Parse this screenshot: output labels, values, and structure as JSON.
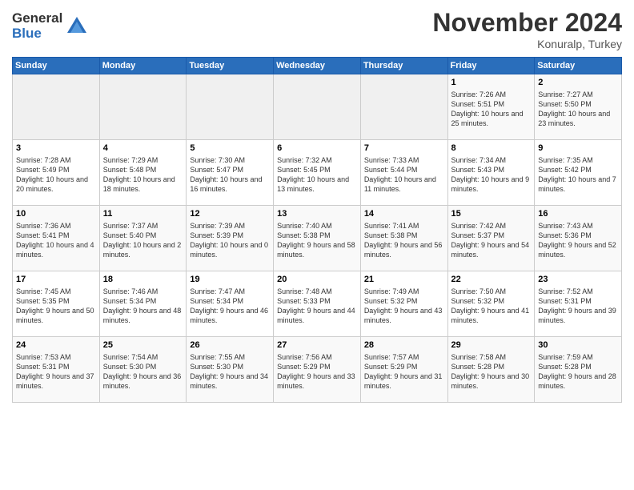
{
  "header": {
    "logo_line1": "General",
    "logo_line2": "Blue",
    "month": "November 2024",
    "location": "Konuralp, Turkey"
  },
  "weekdays": [
    "Sunday",
    "Monday",
    "Tuesday",
    "Wednesday",
    "Thursday",
    "Friday",
    "Saturday"
  ],
  "weeks": [
    [
      {
        "day": "",
        "info": ""
      },
      {
        "day": "",
        "info": ""
      },
      {
        "day": "",
        "info": ""
      },
      {
        "day": "",
        "info": ""
      },
      {
        "day": "",
        "info": ""
      },
      {
        "day": "1",
        "info": "Sunrise: 7:26 AM\nSunset: 5:51 PM\nDaylight: 10 hours and 25 minutes."
      },
      {
        "day": "2",
        "info": "Sunrise: 7:27 AM\nSunset: 5:50 PM\nDaylight: 10 hours and 23 minutes."
      }
    ],
    [
      {
        "day": "3",
        "info": "Sunrise: 7:28 AM\nSunset: 5:49 PM\nDaylight: 10 hours and 20 minutes."
      },
      {
        "day": "4",
        "info": "Sunrise: 7:29 AM\nSunset: 5:48 PM\nDaylight: 10 hours and 18 minutes."
      },
      {
        "day": "5",
        "info": "Sunrise: 7:30 AM\nSunset: 5:47 PM\nDaylight: 10 hours and 16 minutes."
      },
      {
        "day": "6",
        "info": "Sunrise: 7:32 AM\nSunset: 5:45 PM\nDaylight: 10 hours and 13 minutes."
      },
      {
        "day": "7",
        "info": "Sunrise: 7:33 AM\nSunset: 5:44 PM\nDaylight: 10 hours and 11 minutes."
      },
      {
        "day": "8",
        "info": "Sunrise: 7:34 AM\nSunset: 5:43 PM\nDaylight: 10 hours and 9 minutes."
      },
      {
        "day": "9",
        "info": "Sunrise: 7:35 AM\nSunset: 5:42 PM\nDaylight: 10 hours and 7 minutes."
      }
    ],
    [
      {
        "day": "10",
        "info": "Sunrise: 7:36 AM\nSunset: 5:41 PM\nDaylight: 10 hours and 4 minutes."
      },
      {
        "day": "11",
        "info": "Sunrise: 7:37 AM\nSunset: 5:40 PM\nDaylight: 10 hours and 2 minutes."
      },
      {
        "day": "12",
        "info": "Sunrise: 7:39 AM\nSunset: 5:39 PM\nDaylight: 10 hours and 0 minutes."
      },
      {
        "day": "13",
        "info": "Sunrise: 7:40 AM\nSunset: 5:38 PM\nDaylight: 9 hours and 58 minutes."
      },
      {
        "day": "14",
        "info": "Sunrise: 7:41 AM\nSunset: 5:38 PM\nDaylight: 9 hours and 56 minutes."
      },
      {
        "day": "15",
        "info": "Sunrise: 7:42 AM\nSunset: 5:37 PM\nDaylight: 9 hours and 54 minutes."
      },
      {
        "day": "16",
        "info": "Sunrise: 7:43 AM\nSunset: 5:36 PM\nDaylight: 9 hours and 52 minutes."
      }
    ],
    [
      {
        "day": "17",
        "info": "Sunrise: 7:45 AM\nSunset: 5:35 PM\nDaylight: 9 hours and 50 minutes."
      },
      {
        "day": "18",
        "info": "Sunrise: 7:46 AM\nSunset: 5:34 PM\nDaylight: 9 hours and 48 minutes."
      },
      {
        "day": "19",
        "info": "Sunrise: 7:47 AM\nSunset: 5:34 PM\nDaylight: 9 hours and 46 minutes."
      },
      {
        "day": "20",
        "info": "Sunrise: 7:48 AM\nSunset: 5:33 PM\nDaylight: 9 hours and 44 minutes."
      },
      {
        "day": "21",
        "info": "Sunrise: 7:49 AM\nSunset: 5:32 PM\nDaylight: 9 hours and 43 minutes."
      },
      {
        "day": "22",
        "info": "Sunrise: 7:50 AM\nSunset: 5:32 PM\nDaylight: 9 hours and 41 minutes."
      },
      {
        "day": "23",
        "info": "Sunrise: 7:52 AM\nSunset: 5:31 PM\nDaylight: 9 hours and 39 minutes."
      }
    ],
    [
      {
        "day": "24",
        "info": "Sunrise: 7:53 AM\nSunset: 5:31 PM\nDaylight: 9 hours and 37 minutes."
      },
      {
        "day": "25",
        "info": "Sunrise: 7:54 AM\nSunset: 5:30 PM\nDaylight: 9 hours and 36 minutes."
      },
      {
        "day": "26",
        "info": "Sunrise: 7:55 AM\nSunset: 5:30 PM\nDaylight: 9 hours and 34 minutes."
      },
      {
        "day": "27",
        "info": "Sunrise: 7:56 AM\nSunset: 5:29 PM\nDaylight: 9 hours and 33 minutes."
      },
      {
        "day": "28",
        "info": "Sunrise: 7:57 AM\nSunset: 5:29 PM\nDaylight: 9 hours and 31 minutes."
      },
      {
        "day": "29",
        "info": "Sunrise: 7:58 AM\nSunset: 5:28 PM\nDaylight: 9 hours and 30 minutes."
      },
      {
        "day": "30",
        "info": "Sunrise: 7:59 AM\nSunset: 5:28 PM\nDaylight: 9 hours and 28 minutes."
      }
    ]
  ]
}
